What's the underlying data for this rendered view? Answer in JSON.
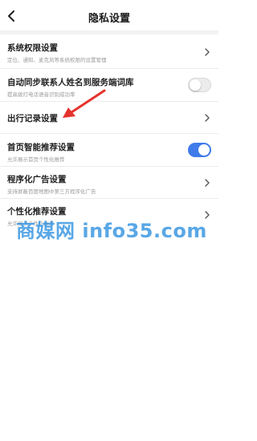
{
  "header": {
    "title": "隐私设置",
    "back_icon": "back-chevron-icon"
  },
  "settings": [
    {
      "title": "系统权限设置",
      "subtitle": "定位、通知、麦克风等系统权限的设置管理",
      "control": "chevron"
    },
    {
      "title": "自动同步联系人姓名到服务端词库",
      "subtitle": "提高拨打电话语音识别成功率",
      "control": "toggle",
      "enabled": false
    },
    {
      "title": "出行记录设置",
      "subtitle": "",
      "control": "chevron"
    },
    {
      "title": "首页智能推荐设置",
      "subtitle": "允许展示首页个性化推荐",
      "control": "toggle",
      "enabled": true
    },
    {
      "title": "程序化广告设置",
      "subtitle": "支持屏蔽百度地图中第三方程序化广告",
      "control": "chevron"
    },
    {
      "title": "个性化推荐设置",
      "subtitle": "允许展示个性化推荐",
      "control": "chevron"
    }
  ],
  "annotation": {
    "color": "#e5322d"
  },
  "watermark": {
    "text": "商媒网 info35.com",
    "color": "#2b8fe0"
  },
  "colors": {
    "toggle_on": "#3f7bea",
    "toggle_off": "#ececec",
    "section_band": "#f2f2f4"
  }
}
